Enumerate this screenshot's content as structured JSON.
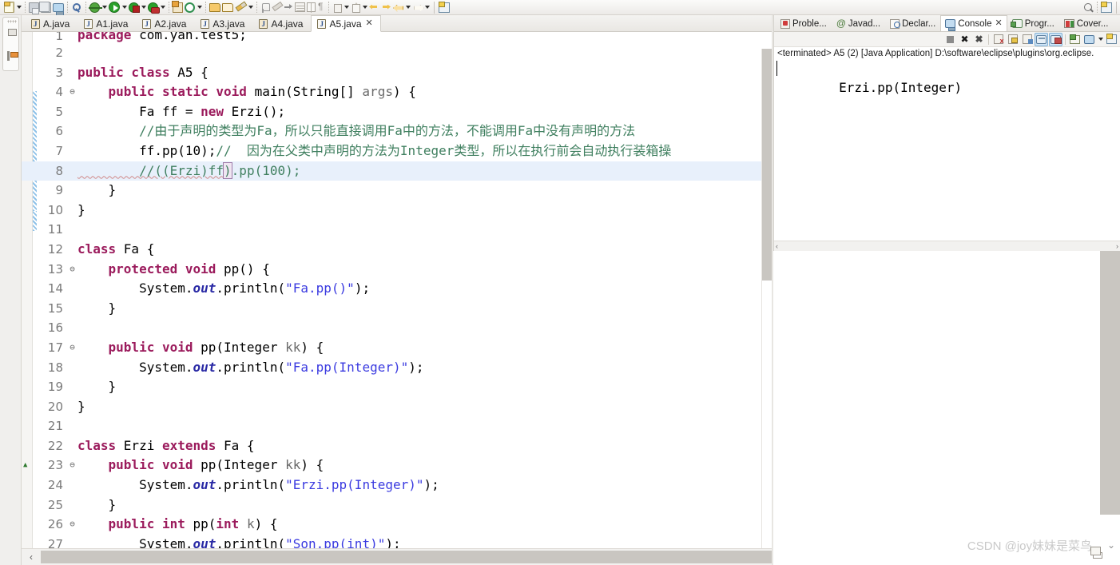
{
  "toolbar": {
    "items": [
      {
        "name": "new-wizard-button",
        "icon": "new-document-icon",
        "dropdown": true
      },
      {
        "name": "save-button",
        "icon": "save-icon",
        "dropdown": false
      },
      {
        "name": "save-all-button",
        "icon": "save-all-icon",
        "dropdown": false
      },
      {
        "name": "print-button",
        "icon": "print-icon",
        "dropdown": false
      },
      {
        "name": "search-button",
        "icon": "search-magnifier-icon",
        "dropdown": false
      },
      {
        "name": "debug-button",
        "icon": "debug-bug-icon",
        "dropdown": true
      },
      {
        "name": "run-button",
        "icon": "run-play-icon",
        "dropdown": true
      },
      {
        "name": "run-config-button",
        "icon": "run-external-tools-icon",
        "dropdown": true
      },
      {
        "name": "coverage-button",
        "icon": "coverage-icon",
        "dropdown": true
      },
      {
        "name": "new-package-button",
        "icon": "new-java-package-icon",
        "dropdown": false
      },
      {
        "name": "new-class-button",
        "icon": "new-java-class-icon",
        "dropdown": true
      },
      {
        "name": "open-type-button",
        "icon": "open-type-icon",
        "dropdown": false
      },
      {
        "name": "open-task-button",
        "icon": "open-task-icon",
        "dropdown": false
      },
      {
        "name": "edit-button",
        "icon": "pencil-icon",
        "dropdown": true
      },
      {
        "name": "pin-editor-button",
        "icon": "pin-icon",
        "dropdown": false
      },
      {
        "name": "brush-button",
        "icon": "brush-icon",
        "dropdown": false
      },
      {
        "name": "skip-breakpoints-button",
        "icon": "arrow-small-icon",
        "dropdown": false
      },
      {
        "name": "toggle-block-selection-button",
        "icon": "table-block-icon",
        "dropdown": false
      },
      {
        "name": "toggle-mark-occurrences-button",
        "icon": "table-column-icon",
        "dropdown": false
      },
      {
        "name": "show-whitespace-button",
        "icon": "pilcrow-icon",
        "dropdown": false
      },
      {
        "name": "next-annotation-button",
        "icon": "next-annotation-icon",
        "dropdown": true
      },
      {
        "name": "previous-annotation-button",
        "icon": "previous-annotation-icon",
        "dropdown": true
      },
      {
        "name": "back-button",
        "icon": "back-arrow-icon",
        "dropdown": false
      },
      {
        "name": "forward-button",
        "icon": "forward-arrow-icon",
        "dropdown": false
      },
      {
        "name": "back-history-button",
        "icon": "back-history-arrow-icon",
        "dropdown": true
      },
      {
        "name": "forward-history-button",
        "icon": "forward-history-arrow-icon",
        "dropdown": true
      },
      {
        "name": "open-perspective-button",
        "icon": "open-perspective-icon",
        "dropdown": false
      }
    ],
    "right_items": [
      {
        "name": "quick-access-search-button",
        "icon": "search-magnifier-icon"
      },
      {
        "name": "open-perspective-button-right",
        "icon": "open-perspective-icon"
      }
    ]
  },
  "left_minimized_stack": {
    "name": "minimized-views-stack",
    "items": [
      {
        "name": "restore-view-icon",
        "label": ""
      },
      {
        "name": "package-explorer-icon",
        "label": ""
      }
    ]
  },
  "editor": {
    "tabs": [
      {
        "label": "A.java",
        "active": false,
        "closable": false
      },
      {
        "label": "A1.java",
        "active": false,
        "closable": false
      },
      {
        "label": "A2.java",
        "active": false,
        "closable": false
      },
      {
        "label": "A3.java",
        "active": false,
        "closable": false
      },
      {
        "label": "A4.java",
        "active": false,
        "closable": false
      },
      {
        "label": "A5.java",
        "active": true,
        "closable": true
      }
    ],
    "close_glyph": "✕",
    "lines": [
      {
        "no": "1",
        "fold": "",
        "clipped": true,
        "highlight": false,
        "tokens": [
          {
            "t": "package ",
            "c": "kw"
          },
          {
            "t": "com.yan.test5;",
            "c": "pln"
          }
        ]
      },
      {
        "no": "2",
        "fold": "",
        "highlight": false,
        "tokens": []
      },
      {
        "no": "3",
        "fold": "",
        "highlight": false,
        "tokens": [
          {
            "t": "public class ",
            "c": "kw"
          },
          {
            "t": "A5 {",
            "c": "pln"
          }
        ]
      },
      {
        "no": "4",
        "fold": "⊖",
        "highlight": false,
        "tokens": [
          {
            "t": "    ",
            "c": "pln"
          },
          {
            "t": "public static void ",
            "c": "kw"
          },
          {
            "t": "main(String[] ",
            "c": "pln"
          },
          {
            "t": "args",
            "c": "par"
          },
          {
            "t": ") {",
            "c": "pln"
          }
        ]
      },
      {
        "no": "5",
        "fold": "",
        "highlight": false,
        "tokens": [
          {
            "t": "        Fa ff = ",
            "c": "pln"
          },
          {
            "t": "new ",
            "c": "kw"
          },
          {
            "t": "Erzi();",
            "c": "pln"
          }
        ]
      },
      {
        "no": "6",
        "fold": "",
        "highlight": false,
        "tokens": [
          {
            "t": "        //由于声明的类型为Fa，所以只能直接调用Fa中的方法，不能调用Fa中没有声明的方法",
            "c": "cmt"
          }
        ]
      },
      {
        "no": "7",
        "fold": "",
        "highlight": false,
        "tokens": [
          {
            "t": "        ff.pp(10);",
            "c": "pln"
          },
          {
            "t": "//  因为在父类中声明的方法为Integer类型，所以在执行前会自动执行装箱操",
            "c": "cmt"
          }
        ]
      },
      {
        "no": "8",
        "fold": "",
        "highlight": true,
        "tokens": [
          {
            "t": "        //((Erzi)ff",
            "c": "cmt"
          },
          {
            "t": ")",
            "c": "cmt-boxed"
          },
          {
            "t": ".pp(100);",
            "c": "cmt"
          }
        ]
      },
      {
        "no": "9",
        "fold": "",
        "highlight": false,
        "tokens": [
          {
            "t": "    }",
            "c": "pln"
          }
        ]
      },
      {
        "no": "10",
        "fold": "",
        "highlight": false,
        "tokens": [
          {
            "t": "}",
            "c": "pln"
          }
        ]
      },
      {
        "no": "11",
        "fold": "",
        "highlight": false,
        "tokens": []
      },
      {
        "no": "12",
        "fold": "",
        "highlight": false,
        "tokens": [
          {
            "t": "class ",
            "c": "kw"
          },
          {
            "t": "Fa {",
            "c": "pln"
          }
        ]
      },
      {
        "no": "13",
        "fold": "⊖",
        "highlight": false,
        "tokens": [
          {
            "t": "    ",
            "c": "pln"
          },
          {
            "t": "protected void ",
            "c": "kw"
          },
          {
            "t": "pp() {",
            "c": "pln"
          }
        ]
      },
      {
        "no": "14",
        "fold": "",
        "highlight": false,
        "tokens": [
          {
            "t": "        System.",
            "c": "pln"
          },
          {
            "t": "out",
            "c": "fld"
          },
          {
            "t": ".println(",
            "c": "pln"
          },
          {
            "t": "\"Fa.pp()\"",
            "c": "str"
          },
          {
            "t": ");",
            "c": "pln"
          }
        ]
      },
      {
        "no": "15",
        "fold": "",
        "highlight": false,
        "tokens": [
          {
            "t": "    }",
            "c": "pln"
          }
        ]
      },
      {
        "no": "16",
        "fold": "",
        "highlight": false,
        "tokens": []
      },
      {
        "no": "17",
        "fold": "⊖",
        "highlight": false,
        "tokens": [
          {
            "t": "    ",
            "c": "pln"
          },
          {
            "t": "public void ",
            "c": "kw"
          },
          {
            "t": "pp(Integer ",
            "c": "pln"
          },
          {
            "t": "kk",
            "c": "par"
          },
          {
            "t": ") {",
            "c": "pln"
          }
        ]
      },
      {
        "no": "18",
        "fold": "",
        "highlight": false,
        "tokens": [
          {
            "t": "        System.",
            "c": "pln"
          },
          {
            "t": "out",
            "c": "fld"
          },
          {
            "t": ".println(",
            "c": "pln"
          },
          {
            "t": "\"Fa.pp(Integer)\"",
            "c": "str"
          },
          {
            "t": ");",
            "c": "pln"
          }
        ]
      },
      {
        "no": "19",
        "fold": "",
        "highlight": false,
        "tokens": [
          {
            "t": "    }",
            "c": "pln"
          }
        ]
      },
      {
        "no": "20",
        "fold": "",
        "highlight": false,
        "tokens": [
          {
            "t": "}",
            "c": "pln"
          }
        ]
      },
      {
        "no": "21",
        "fold": "",
        "highlight": false,
        "tokens": []
      },
      {
        "no": "22",
        "fold": "",
        "highlight": false,
        "tokens": [
          {
            "t": "class ",
            "c": "kw"
          },
          {
            "t": "Erzi ",
            "c": "pln"
          },
          {
            "t": "extends ",
            "c": "kw"
          },
          {
            "t": "Fa {",
            "c": "pln"
          }
        ]
      },
      {
        "no": "23",
        "fold": "⊖",
        "marker": "▲",
        "highlight": false,
        "tokens": [
          {
            "t": "    ",
            "c": "pln"
          },
          {
            "t": "public void ",
            "c": "kw"
          },
          {
            "t": "pp(Integer ",
            "c": "pln"
          },
          {
            "t": "kk",
            "c": "par"
          },
          {
            "t": ") {",
            "c": "pln"
          }
        ]
      },
      {
        "no": "24",
        "fold": "",
        "highlight": false,
        "tokens": [
          {
            "t": "        System.",
            "c": "pln"
          },
          {
            "t": "out",
            "c": "fld"
          },
          {
            "t": ".println(",
            "c": "pln"
          },
          {
            "t": "\"Erzi.pp(Integer)\"",
            "c": "str"
          },
          {
            "t": ");",
            "c": "pln"
          }
        ]
      },
      {
        "no": "25",
        "fold": "",
        "highlight": false,
        "tokens": [
          {
            "t": "    }",
            "c": "pln"
          }
        ]
      },
      {
        "no": "26",
        "fold": "⊖",
        "highlight": false,
        "tokens": [
          {
            "t": "    ",
            "c": "pln"
          },
          {
            "t": "public int ",
            "c": "kw"
          },
          {
            "t": "pp(",
            "c": "pln"
          },
          {
            "t": "int ",
            "c": "kw"
          },
          {
            "t": "k",
            "c": "par"
          },
          {
            "t": ") {",
            "c": "pln"
          }
        ]
      },
      {
        "no": "27",
        "fold": "",
        "highlight": false,
        "tokens": [
          {
            "t": "        System.",
            "c": "pln"
          },
          {
            "t": "out",
            "c": "fld"
          },
          {
            "t": ".println(",
            "c": "pln"
          },
          {
            "t": "\"Son.pp(int)\"",
            "c": "str"
          },
          {
            "t": ");",
            "c": "pln"
          }
        ]
      }
    ],
    "hscroll_left_glyph": "‹"
  },
  "console_panel": {
    "tabs": [
      {
        "label": "Proble...",
        "icon": "problems-icon",
        "active": false,
        "closable": false
      },
      {
        "label": "Javad...",
        "icon": "javadoc-icon",
        "active": false,
        "closable": false
      },
      {
        "label": "Declar...",
        "icon": "declaration-icon",
        "active": false,
        "closable": false
      },
      {
        "label": "Console",
        "icon": "console-icon",
        "active": true,
        "closable": true
      },
      {
        "label": "Progr...",
        "icon": "progress-icon",
        "active": false,
        "closable": false
      },
      {
        "label": "Cover...",
        "icon": "coverage-view-icon",
        "active": false,
        "closable": false
      }
    ],
    "close_glyph": "✕",
    "toolbar": [
      {
        "name": "terminate-button",
        "icon": "stop-square-icon",
        "selected": false
      },
      {
        "name": "remove-launch-button",
        "icon": "remove-x-icon",
        "selected": false
      },
      {
        "name": "remove-all-terminated-button",
        "icon": "remove-all-icon",
        "selected": false
      },
      {
        "name": "clear-console-button",
        "icon": "clear-console-icon",
        "selected": false
      },
      {
        "name": "scroll-lock-button",
        "icon": "scroll-lock-icon",
        "selected": false
      },
      {
        "name": "word-wrap-button",
        "icon": "word-wrap-icon",
        "selected": false
      },
      {
        "name": "show-console-on-output-button",
        "icon": "display-standard-out-icon",
        "selected": true
      },
      {
        "name": "show-console-on-error-button",
        "icon": "display-standard-err-icon",
        "selected": true
      },
      {
        "name": "open-console-button",
        "icon": "open-console-icon",
        "selected": false
      },
      {
        "name": "display-selected-console-button",
        "icon": "display-console-icon",
        "selected": false
      },
      {
        "name": "pin-console-button",
        "icon": "pin-console-icon",
        "selected": false
      }
    ],
    "launch_header": "<terminated> A5 (2) [Java Application] D:\\software\\eclipse\\plugins\\org.eclipse.",
    "output": "Erzi.pp(Integer)",
    "hscroll_left_glyph": "‹",
    "hscroll_right_glyph": "›"
  },
  "watermark": {
    "text": "CSDN @joy妹妹是菜鸟"
  },
  "colors": {
    "keyword": "#9b1b5c",
    "string": "#3a3ae0",
    "comment": "#3f7f5f",
    "field": "#2a2aa5",
    "highlight_line": "#e8f0fb",
    "tab_active_bg": "#ffffff",
    "toolbar_bg": "#f2f1ef",
    "selected_toolbutton": "#cfe4f5"
  }
}
